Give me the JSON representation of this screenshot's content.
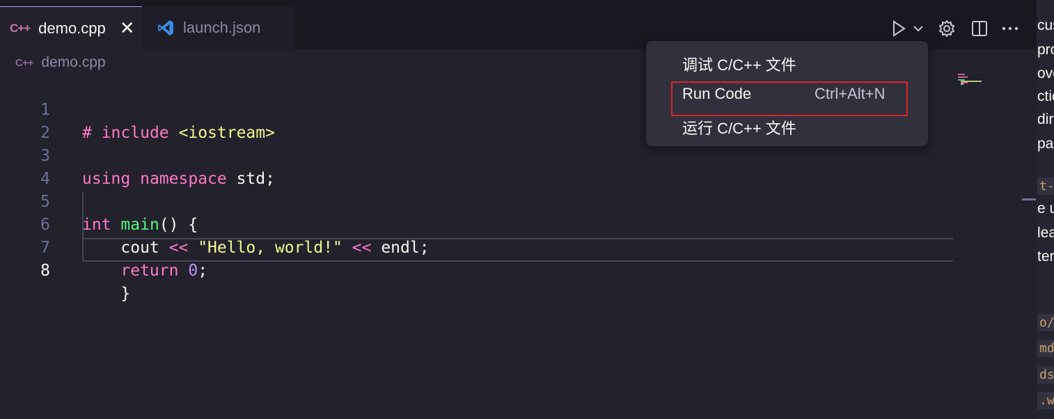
{
  "tabs": [
    {
      "icon": "cpp-icon",
      "label": "demo.cpp",
      "active": true
    },
    {
      "icon": "vscode-icon",
      "label": "launch.json",
      "active": false
    }
  ],
  "breadcrumb": {
    "file": "demo.cpp"
  },
  "code_lines": [
    {
      "num": "1"
    },
    {
      "num": "2"
    },
    {
      "num": "3"
    },
    {
      "num": "4"
    },
    {
      "num": "5"
    },
    {
      "num": "6"
    },
    {
      "num": "7"
    },
    {
      "num": "8"
    }
  ],
  "code": {
    "l1_hash": "# ",
    "l1_kw": "include",
    "l1_space": " ",
    "l1_str": "<iostream>",
    "l3_kw1": "using",
    "l3_kw2": "namespace",
    "l3_rest": " std;",
    "l5_kw": "int",
    "l5_fn": "main",
    "l5_rest": "() {",
    "l6_a": "    cout ",
    "l6_op1": "<<",
    "l6_str": "\"Hello, world!\"",
    "l6_op2": "<<",
    "l6_b": " endl;",
    "l7_kw": "return",
    "l7_num": "0",
    "l7_rest": ";",
    "l8": "    }"
  },
  "menu": {
    "items": [
      {
        "label": "调试 C/C++ 文件",
        "shortcut": ""
      },
      {
        "label": "Run Code",
        "shortcut": "Ctrl+Alt+N"
      },
      {
        "label": "运行 C/C++ 文件",
        "shortcut": ""
      }
    ]
  },
  "right_panel": {
    "fragments": [
      "cus",
      "pro",
      "ove",
      "ctic",
      "dire",
      " pa",
      "t-",
      "e u",
      "lea",
      "tera",
      "o/c",
      "md",
      "ds",
      ".w"
    ]
  },
  "colors": {
    "accent": "#bd93f9",
    "highlight": "#e0242b"
  }
}
